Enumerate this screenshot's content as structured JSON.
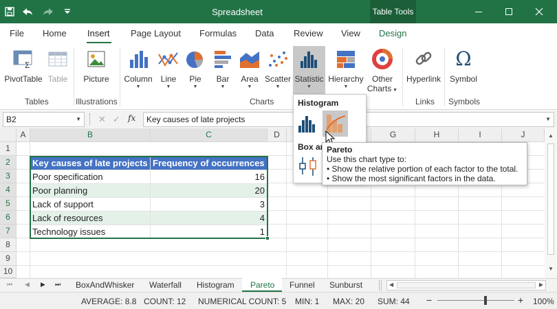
{
  "app": {
    "title": "Spreadsheet",
    "context_tab": "Table Tools",
    "quick_access_icons": [
      "save-icon",
      "undo-icon",
      "redo-icon",
      "customize-quick-access-icon"
    ],
    "window_icons": [
      "minimize-icon",
      "maximize-icon",
      "close-icon"
    ]
  },
  "tabs": [
    {
      "label": "File"
    },
    {
      "label": "Home"
    },
    {
      "label": "Insert"
    },
    {
      "label": "Page Layout"
    },
    {
      "label": "Formulas"
    },
    {
      "label": "Data"
    },
    {
      "label": "Review"
    },
    {
      "label": "View"
    },
    {
      "label": "Design"
    }
  ],
  "active_tab": "Insert",
  "ribbon": {
    "groups": [
      "Tables",
      "Illustrations",
      "Charts",
      "Links",
      "Symbols"
    ],
    "buttons": [
      {
        "label": "PivotTable",
        "icon": "pivot-table-icon"
      },
      {
        "label": "Table",
        "icon": "table-icon",
        "disabled": true
      },
      {
        "label": "Picture",
        "icon": "picture-icon"
      },
      {
        "label": "Column",
        "icon": "column-chart-icon"
      },
      {
        "label": "Line",
        "icon": "line-chart-icon"
      },
      {
        "label": "Pie",
        "icon": "pie-chart-icon"
      },
      {
        "label": "Bar",
        "icon": "bar-chart-icon"
      },
      {
        "label": "Area",
        "icon": "area-chart-icon"
      },
      {
        "label": "Scatter",
        "icon": "scatter-chart-icon"
      },
      {
        "label": "Statistic",
        "icon": "statistic-chart-icon",
        "selected": true
      },
      {
        "label": "Hierarchy",
        "icon": "hierarchy-chart-icon"
      },
      {
        "label": "Other",
        "label2": "Charts",
        "icon": "other-charts-icon"
      },
      {
        "label": "Hyperlink",
        "icon": "hyperlink-icon"
      },
      {
        "label": "Symbol",
        "icon": "symbol-icon",
        "glyph": "Ω"
      }
    ]
  },
  "formula_bar": {
    "name_box": "B2",
    "formula": "Key causes of late projects",
    "fx": "fx"
  },
  "columns": [
    "A",
    "B",
    "C",
    "D",
    "E",
    "F",
    "G",
    "H",
    "I",
    "J"
  ],
  "rows": [
    "1",
    "2",
    "3",
    "4",
    "5",
    "6",
    "7",
    "8",
    "9",
    "10"
  ],
  "table": {
    "header": [
      "Key causes of late projects",
      "Frequency of occurrences"
    ],
    "rows": [
      [
        "Poor specification",
        "16"
      ],
      [
        "Poor planning",
        "20"
      ],
      [
        "Lack of support",
        "3"
      ],
      [
        "Lack of resources",
        "4"
      ],
      [
        "Technology issues",
        "1"
      ]
    ]
  },
  "dropdown": {
    "section1": "Histogram",
    "section2": "Box ar",
    "items": [
      {
        "name": "histogram-chart-icon"
      },
      {
        "name": "pareto-chart-icon"
      },
      {
        "name": "box-whisker-chart-icon"
      }
    ]
  },
  "tooltip": {
    "title": "Pareto",
    "line1": "Use this chart type to:",
    "line2": "• Show the relative portion of each factor to the total.",
    "line3": "• Show the most significant factors in the data."
  },
  "sheets": [
    "BoxAndWhisker",
    "Waterfall",
    "Histogram",
    "Pareto",
    "Funnel",
    "Sunburst"
  ],
  "active_sheet": "Pareto",
  "status": {
    "average": "AVERAGE: 8.8",
    "count": "COUNT: 12",
    "numerical_count": "NUMERICAL COUNT: 5",
    "min": "MIN: 1",
    "max": "MAX: 20",
    "sum": "SUM: 44",
    "zoom": "100%",
    "zoom_level": 1.0
  },
  "colors": {
    "accent": "#217346",
    "table_header": "#4472c4",
    "band": "#e4f1e9"
  }
}
